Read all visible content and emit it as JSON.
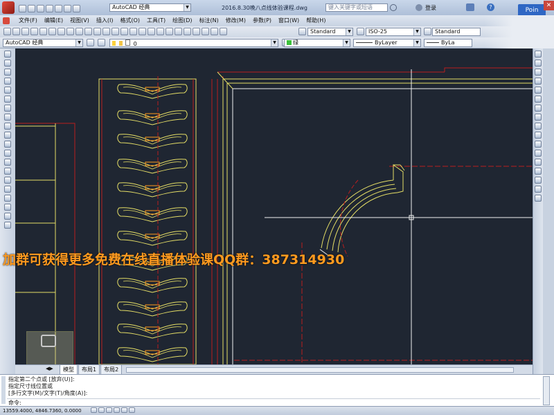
{
  "title_bar": {
    "workspace": "AutoCAD 经典",
    "document_title": "2016.8.30晚八点线体验课程.dwg",
    "search_placeholder": "键入关键字或短语",
    "login": "登录",
    "floating_tag": "Poin"
  },
  "menu": {
    "items": [
      "文件(F)",
      "编辑(E)",
      "视图(V)",
      "插入(I)",
      "格式(O)",
      "工具(T)",
      "绘图(D)",
      "标注(N)",
      "修改(M)",
      "参数(P)",
      "窗口(W)",
      "帮助(H)"
    ]
  },
  "styles_toolbar": {
    "text_style": "Standard",
    "dim_style": "ISO-25",
    "table_style": "Standard"
  },
  "layers_toolbar": {
    "workspace": "AutoCAD 经典",
    "layer": "0",
    "color": "绿",
    "linetype": "ByLayer",
    "lineweight": "ByLa"
  },
  "watermark": {
    "text": "加群可获得更多免费在线直播体验课QQ群：387314930"
  },
  "layout_tabs": [
    "模型",
    "布局1",
    "布局2"
  ],
  "command": {
    "history": [
      "指定第二个点或 [放弃(U)]:",
      "指定尺寸线位置或",
      "[多行文字(M)/文字(T)/角度(A)]:"
    ],
    "prompt": "命令:"
  },
  "status_bar": {
    "coordinates": "13559.4000, 4846.7360, 0.0000"
  },
  "colors": {
    "canvas": "#1f2632",
    "red_lines": "#b91e1e",
    "yellow_lines": "#e6df66",
    "white_lines": "#f2f2f2",
    "watermark": "#ff9a1f"
  }
}
